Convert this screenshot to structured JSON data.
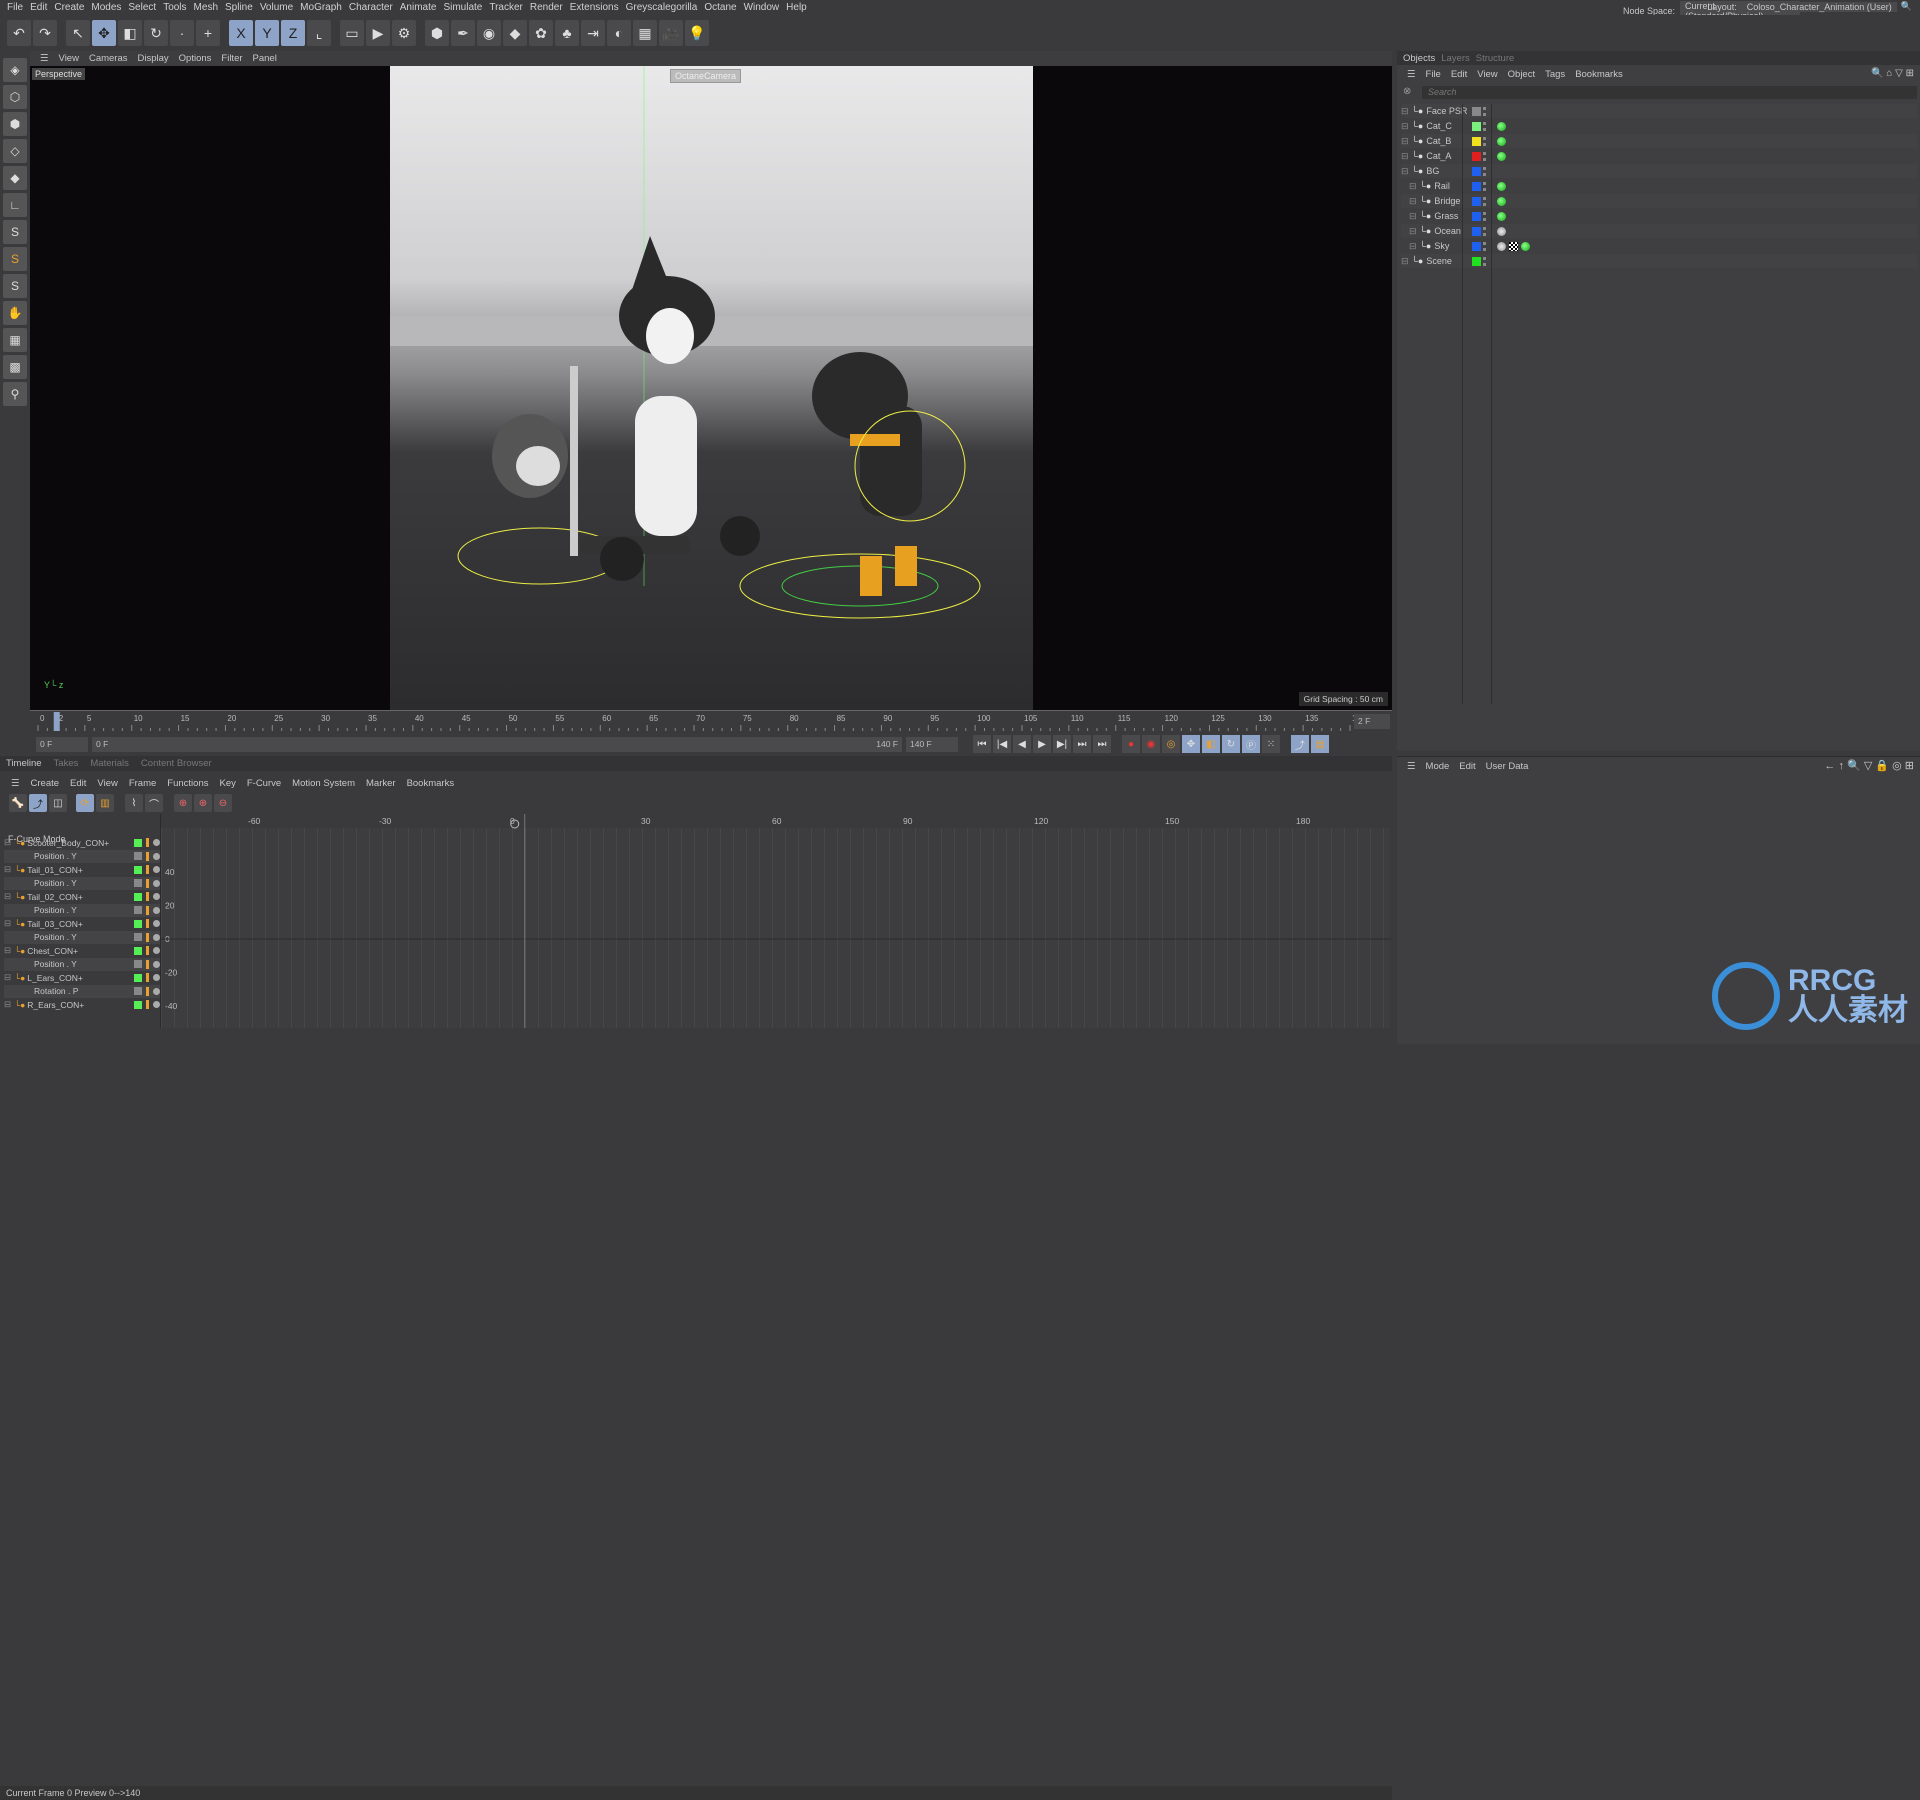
{
  "menu": [
    "File",
    "Edit",
    "Create",
    "Modes",
    "Select",
    "Tools",
    "Mesh",
    "Spline",
    "Volume",
    "MoGraph",
    "Character",
    "Animate",
    "Simulate",
    "Tracker",
    "Render",
    "Extensions",
    "Greyscalegorilla",
    "Octane",
    "Window",
    "Help"
  ],
  "node_space": {
    "label": "Node Space:",
    "value": "Current (Standard/Physical)"
  },
  "layout": {
    "label": "Layout:",
    "value": "Coloso_Character_Animation (User)"
  },
  "toolbar_icons": [
    "undo-icon",
    "redo-icon",
    "select-icon",
    "move-icon",
    "scale-icon",
    "rotate-icon",
    "dim-icon",
    "add-icon",
    "x-axis-icon",
    "y-axis-icon",
    "z-axis-icon",
    "coord-icon",
    "render-view-icon",
    "render-icon",
    "render-settings-icon",
    "cube-icon",
    "pen-icon",
    "subdiv-icon",
    "extrude-icon",
    "mograph-icon",
    "cloner-icon",
    "deformer-icon",
    "field-icon",
    "floor-icon",
    "camera-icon",
    "light-icon"
  ],
  "toolbar_glyphs": [
    "↶",
    "↷",
    "↖",
    "✥",
    "◧",
    "↻",
    "·",
    "+",
    "X",
    "Y",
    "Z",
    "⌞",
    "▭",
    "▶",
    "⚙",
    "⬢",
    "✒",
    "◉",
    "◆",
    "✿",
    "♣",
    "⇥",
    "◐",
    "▦",
    "🎥",
    "💡"
  ],
  "viewport": {
    "menu": [
      "View",
      "Cameras",
      "Display",
      "Options",
      "Filter",
      "Panel"
    ],
    "label": "Perspective",
    "camera": "OctaneCamera",
    "grid_spacing": "Grid Spacing : 50 cm"
  },
  "ruler": {
    "ticks": [
      "0",
      "2",
      "5",
      "10",
      "15",
      "20",
      "25",
      "30",
      "35",
      "40",
      "45",
      "50",
      "55",
      "60",
      "65",
      "70",
      "75",
      "80",
      "85",
      "90",
      "95",
      "100",
      "105",
      "110",
      "115",
      "120",
      "125",
      "130",
      "135",
      "140"
    ],
    "current": 2,
    "max": 140,
    "fps_field": "2 F"
  },
  "range": {
    "start": "0 F",
    "range_start": "0 F",
    "range_end": "140 F",
    "end": "140 F"
  },
  "objects": {
    "tabs": [
      "Objects",
      "Layers",
      "Structure"
    ],
    "menu": [
      "File",
      "Edit",
      "View",
      "Object",
      "Tags",
      "Bookmarks"
    ],
    "search_placeholder": "Search",
    "rows": [
      {
        "name": "Face PSR",
        "color": "#888888",
        "indent": 0,
        "tags": []
      },
      {
        "name": "Cat_C",
        "color": "#7cf07c",
        "indent": 0,
        "tags": [
          "green"
        ]
      },
      {
        "name": "Cat_B",
        "color": "#f0e020",
        "indent": 0,
        "tags": [
          "green"
        ]
      },
      {
        "name": "Cat_A",
        "color": "#e02020",
        "indent": 0,
        "tags": [
          "green"
        ]
      },
      {
        "name": "BG",
        "color": "#2060f0",
        "indent": 0,
        "tags": []
      },
      {
        "name": "Rail",
        "color": "#2060f0",
        "indent": 1,
        "tags": [
          "green"
        ]
      },
      {
        "name": "Bridge",
        "color": "#2060f0",
        "indent": 1,
        "tags": [
          "green"
        ]
      },
      {
        "name": "Grass",
        "color": "#2060f0",
        "indent": 1,
        "tags": [
          "green"
        ]
      },
      {
        "name": "Ocean",
        "color": "#2060f0",
        "indent": 1,
        "tags": [
          "material"
        ]
      },
      {
        "name": "Sky",
        "color": "#2060f0",
        "indent": 1,
        "tags": [
          "material",
          "checker",
          "green"
        ]
      },
      {
        "name": "Scene",
        "color": "#20e020",
        "indent": 0,
        "tags": []
      }
    ]
  },
  "attributes": {
    "menu": [
      "Mode",
      "Edit",
      "User Data"
    ]
  },
  "timeline": {
    "tabs": [
      "Timeline",
      "Takes",
      "Materials",
      "Content Browser"
    ],
    "menu": [
      "Create",
      "Edit",
      "View",
      "Frame",
      "Functions",
      "Key",
      "F-Curve",
      "Motion System",
      "Marker",
      "Bookmarks"
    ],
    "mode_label": "F-Curve Mode",
    "tracks": [
      {
        "name": "Scooter_Body_CON+",
        "type": "object"
      },
      {
        "name": "Position . Y",
        "type": "param"
      },
      {
        "name": "Tail_01_CON+",
        "type": "object"
      },
      {
        "name": "Position . Y",
        "type": "param"
      },
      {
        "name": "Tail_02_CON+",
        "type": "object"
      },
      {
        "name": "Position . Y",
        "type": "param"
      },
      {
        "name": "Tail_03_CON+",
        "type": "object"
      },
      {
        "name": "Position . Y",
        "type": "param"
      },
      {
        "name": "Chest_CON+",
        "type": "object"
      },
      {
        "name": "Position . Y",
        "type": "param"
      },
      {
        "name": "L_Ears_CON+",
        "type": "object"
      },
      {
        "name": "Rotation . P",
        "type": "param"
      },
      {
        "name": "R_Ears_CON+",
        "type": "object"
      }
    ],
    "x_ticks": [
      "-60",
      "-30",
      "0",
      "30",
      "60",
      "90",
      "120",
      "150",
      "180"
    ],
    "y_ticks": [
      "40",
      "20",
      "0",
      "-20",
      "-40"
    ],
    "playhead_frame": 2,
    "status": "Current Frame  0  Preview  0-->140"
  },
  "watermark": "RRCG 人人素材"
}
